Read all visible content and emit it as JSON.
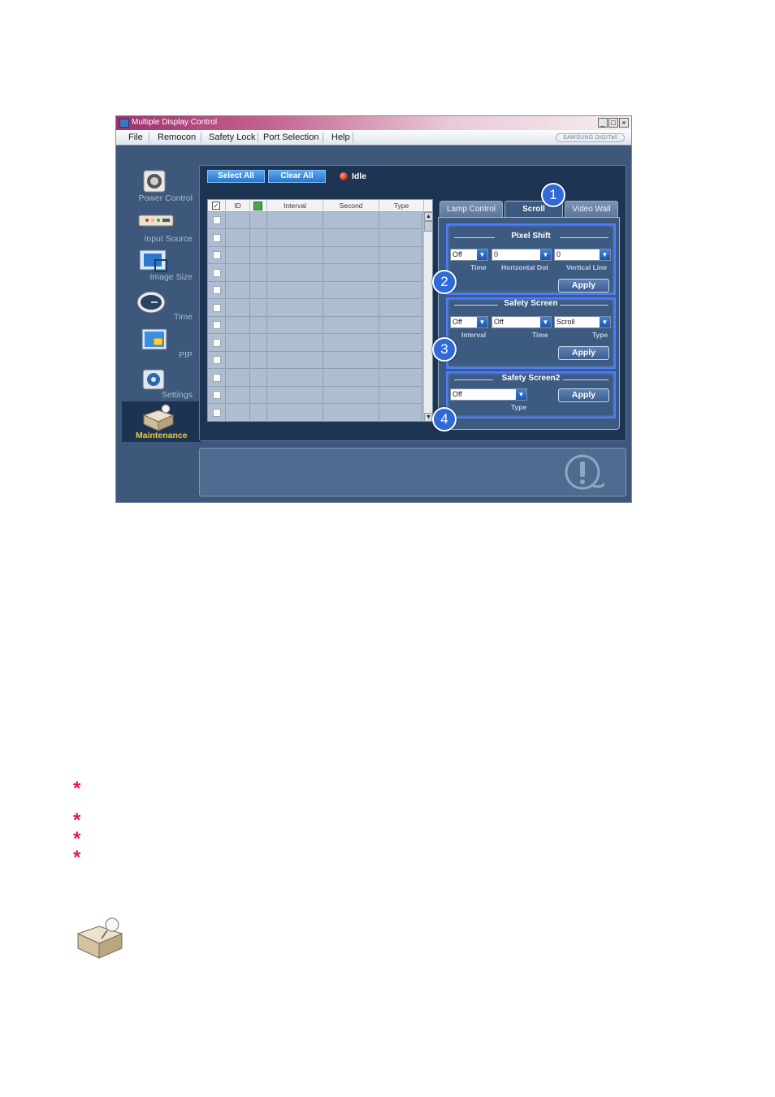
{
  "window": {
    "title": "Multiple Display Control",
    "buttons": [
      "_",
      "□",
      "×"
    ],
    "brand": "SAMSUNG DIGITall"
  },
  "menu": [
    "File",
    "Remocon",
    "Safety Lock",
    "Port Selection",
    "Help"
  ],
  "sidebar": {
    "items": [
      {
        "label": "Power Control",
        "icon": "power-control-icon"
      },
      {
        "label": "Input Source",
        "icon": "input-source-icon"
      },
      {
        "label": "Image Size",
        "icon": "image-size-icon"
      },
      {
        "label": "Time",
        "icon": "clock-icon"
      },
      {
        "label": "PIP",
        "icon": "pip-icon"
      },
      {
        "label": "Settings",
        "icon": "settings-icon"
      },
      {
        "label": "Maintenance",
        "icon": "maintenance-icon",
        "active": true
      }
    ]
  },
  "toolbar": {
    "select_all": "Select All",
    "clear_all": "Clear All",
    "status": "Idle"
  },
  "grid": {
    "columns": [
      "ID",
      "Interval",
      "Second",
      "Type"
    ],
    "row_count": 12
  },
  "tabs": [
    "Lamp Control",
    "Scroll",
    "Video Wall"
  ],
  "active_tab": "Scroll",
  "pixel_shift": {
    "title": "Pixel Shift",
    "time": {
      "value": "Off",
      "label": "Time"
    },
    "horizontal_dot": {
      "value": "0",
      "label": "Horizontal Dot"
    },
    "vertical_line": {
      "value": "0",
      "label": "Vertical Line"
    },
    "apply": "Apply"
  },
  "safety_screen": {
    "title": "Safety Screen",
    "interval": {
      "value": "Off",
      "label": "Interval"
    },
    "time": {
      "value": "Off",
      "label": "Time"
    },
    "type": {
      "value": "Scroll",
      "label": "Type"
    },
    "apply": "Apply"
  },
  "safety_screen2": {
    "title": "Safety Screen2",
    "type": {
      "value": "Off",
      "label": "Type"
    },
    "apply": "Apply"
  },
  "callouts": [
    "1",
    "2",
    "3",
    "4"
  ],
  "colors": {
    "window_bg": "#3d587a",
    "panel_dark": "#1d3452",
    "accent_blue": "#2f6ad8",
    "highlight_border": "#4f7dff",
    "maintenance_label": "#f3c53a",
    "bullet_star": "#e8185c"
  },
  "doc": {
    "bullets": [
      "*",
      "*",
      "*",
      "*"
    ]
  }
}
